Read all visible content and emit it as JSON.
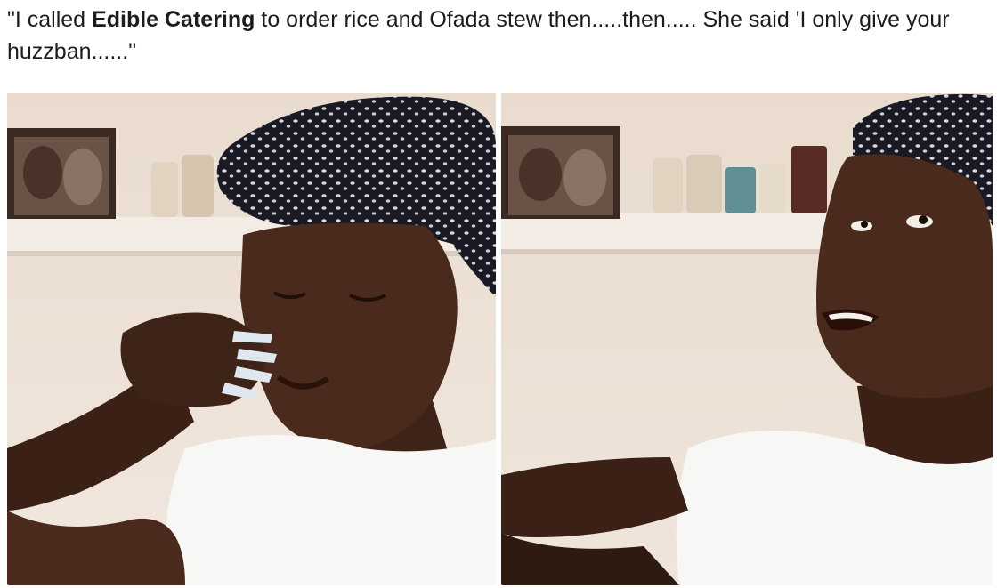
{
  "caption": {
    "before": "\"I called ",
    "bold": "Edible Catering",
    "after": " to order rice and Ofada  stew then.....then..... She said 'I only give your huzzban......\""
  },
  "panels": [
    {
      "subject": "woman-crying-holding-nose"
    },
    {
      "subject": "woman-looking-up-talking"
    }
  ],
  "colors": {
    "wall": "#efe6dc",
    "skin": "#4a2a1c",
    "headscarf": "#1a1a24",
    "shirt": "#f7f7f5",
    "nails": "#dfe8f0"
  }
}
